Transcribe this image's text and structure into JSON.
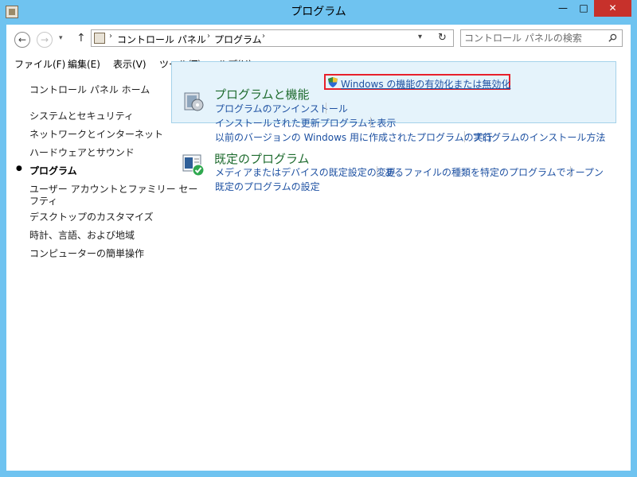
{
  "window": {
    "title": "プログラム",
    "min_glyph": "—",
    "max_glyph": "□",
    "close_glyph": "✕"
  },
  "nav": {
    "back_glyph": "←",
    "forward_glyph": "→",
    "recent_glyph": "▾",
    "up_glyph": "↑",
    "breadcrumb": [
      "コントロール パネル",
      "プログラム"
    ],
    "refresh_glyph": "↻",
    "search_placeholder": "コントロール パネルの検索"
  },
  "menu": [
    "ファイル(F)",
    "編集(E)",
    "表示(V)",
    "ツール(T)",
    "ヘルプ(H)"
  ],
  "left_pane": {
    "home": "コントロール パネル ホーム",
    "items": [
      "システムとセキュリティ",
      "ネットワークとインターネット",
      "ハードウェアとサウンド",
      "プログラム",
      "ユーザー アカウントとファミリー セー",
      "フティ",
      "デスクトップのカスタマイズ",
      "時計、言語、および地域",
      "コンピューターの簡単操作"
    ],
    "current_bullet": "●"
  },
  "groups": {
    "programs_features": {
      "title": "プログラムと機能",
      "links": [
        "プログラムのアンインストール",
        "Windows の機能の有効化または無効化",
        "インストールされた更新プログラムを表示",
        "以前のバージョンの Windows 用に作成されたプログラムの実行",
        "プログラムのインストール方法"
      ]
    },
    "default_programs": {
      "title": "既定のプログラム",
      "links": [
        "メディアまたはデバイスの既定設定の変更",
        "あるファイルの種類を特定のプログラムでオープン",
        "既定のプログラムの設定"
      ]
    }
  },
  "colors": {
    "titlebar": "#6fc3f0",
    "close": "#c7312b",
    "link": "#1e51a2",
    "group_title": "#1e6b2e",
    "highlight_border": "#e8202b",
    "group_bg": "#e5f3fb"
  }
}
